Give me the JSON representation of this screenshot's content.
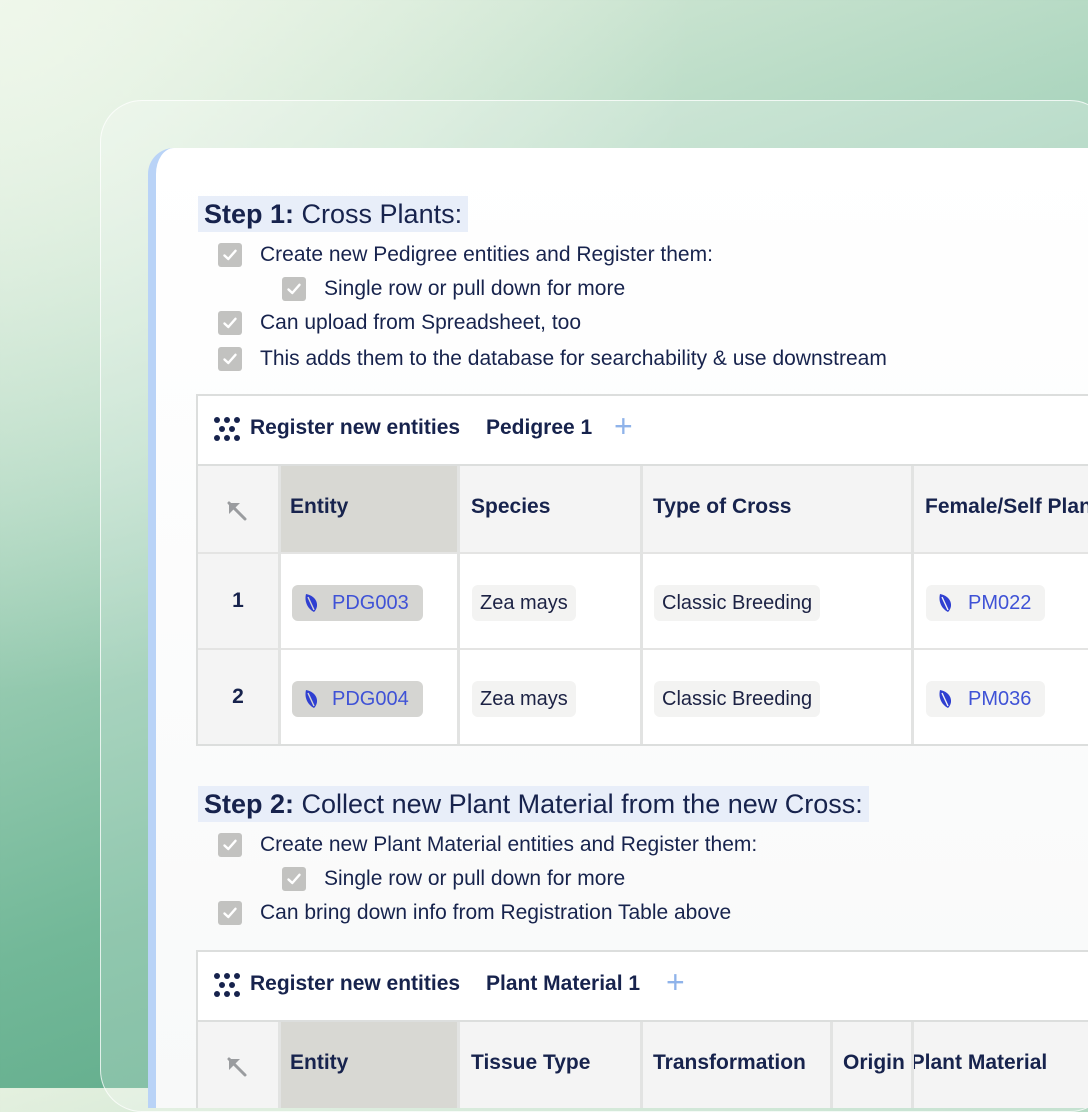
{
  "step1": {
    "heading_bold": "Step 1:",
    "heading_rest": " Cross Plants:",
    "checks": [
      "Create new Pedigree entities and Register them:",
      "Single row or pull down for more",
      "Can upload from Spreadsheet, too",
      "This adds them to the database for searchability & use downstream"
    ],
    "widget": {
      "title": "Register new entities",
      "tab": "Pedigree 1",
      "columns": [
        "Entity",
        "Species",
        "Type of Cross",
        "Female/Self Plan"
      ],
      "rows": [
        {
          "num": "1",
          "entity": "PDG003",
          "species": "Zea mays",
          "cross": "Classic Breeding",
          "female": "PM022"
        },
        {
          "num": "2",
          "entity": "PDG004",
          "species": "Zea mays",
          "cross": "Classic Breeding",
          "female": "PM036"
        }
      ]
    }
  },
  "step2": {
    "heading_bold": "Step 2:",
    "heading_rest": " Collect new Plant Material from the new Cross:",
    "checks": [
      "Create new Plant Material entities and Register them:",
      "Single row or pull down for more",
      "Can bring down info from Registration Table above"
    ],
    "widget": {
      "title": "Register new entities",
      "tab": "Plant Material 1",
      "columns": [
        "Entity",
        "Tissue Type",
        "Transformation",
        "Origin Plant Material"
      ]
    }
  },
  "icons": {
    "checkbox": "checkbox-checked-icon",
    "grid": "grid-dots-icon",
    "add": "plus-icon",
    "leaf": "leaf-icon",
    "corner": "arrow-up-left-icon"
  },
  "colors": {
    "accent": "#3f52d6",
    "text": "#17234d",
    "heading_highlight": "#e8eef9",
    "panel_border": "#b9d3f7"
  }
}
